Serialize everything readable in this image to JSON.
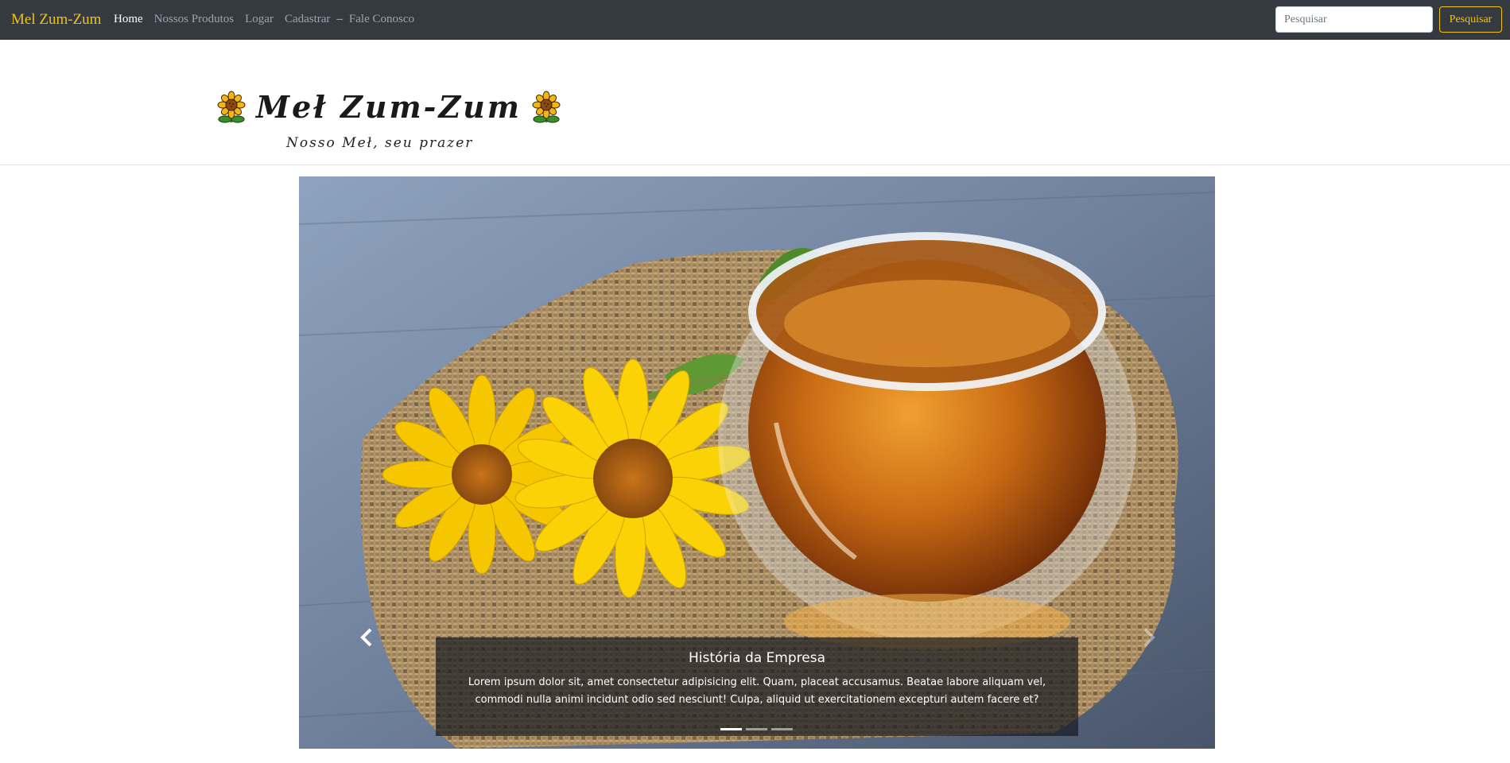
{
  "navbar": {
    "brand": "Mel Zum-Zum",
    "links": [
      {
        "label": "Home",
        "active": true
      },
      {
        "label": "Nossos Produtos",
        "active": false
      },
      {
        "label": "Logar",
        "active": false
      },
      {
        "label": "Cadastrar",
        "active": false
      },
      {
        "label": "Fale Conosco",
        "active": false
      }
    ],
    "separator": "–",
    "search": {
      "placeholder": "Pesquisar",
      "value": "",
      "button_label": "Pesquisar"
    }
  },
  "header": {
    "title": "Meł Zum-Zum",
    "tagline": "Nosso Meł, seu prazer",
    "icon": "sunflower-icon"
  },
  "carousel": {
    "slide_icon": "honey-cup-with-flowers-photo",
    "prev_icon": "chevron-left-icon",
    "next_icon": "chevron-right-icon",
    "caption_title": "História da Empresa",
    "caption_text": "Lorem ipsum dolor sit, amet consectetur adipisicing elit. Quam, placeat accusamus. Beatae labore aliquam vel, commodi nulla animi incidunt odio sed nesciunt! Culpa, aliquid ut exercitationem excepturi autem facere et?",
    "slide_count": 3,
    "active_slide": 1
  },
  "colors": {
    "navbar_bg": "#343a40",
    "brand": "#f1c40f",
    "link": "#9ea4aa",
    "link_active": "#ffffff"
  }
}
